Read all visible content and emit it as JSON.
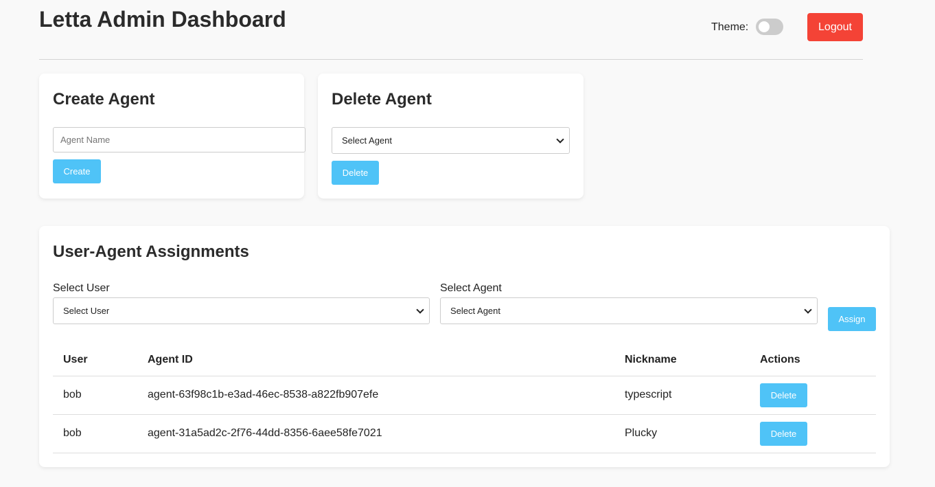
{
  "header": {
    "title": "Letta Admin Dashboard",
    "theme_label": "Theme:",
    "logout_label": "Logout"
  },
  "create_agent": {
    "heading": "Create Agent",
    "name_placeholder": "Agent Name",
    "name_value": "",
    "create_label": "Create"
  },
  "delete_agent": {
    "heading": "Delete Agent",
    "select_value": "Select Agent",
    "delete_label": "Delete"
  },
  "assignments": {
    "heading": "User-Agent Assignments",
    "user_label": "Select User",
    "user_select_value": "Select User",
    "agent_label": "Select Agent",
    "agent_select_value": "Select Agent",
    "assign_label": "Assign",
    "columns": [
      "User",
      "Agent ID",
      "Nickname",
      "Actions"
    ],
    "rows": [
      {
        "user": "bob",
        "agent_id": "agent-63f98c1b-e3ad-46ec-8538-a822fb907efe",
        "nickname": "typescript",
        "action_label": "Delete"
      },
      {
        "user": "bob",
        "agent_id": "agent-31a5ad2c-2f76-44dd-8356-6aee58fe7021",
        "nickname": "Plucky",
        "action_label": "Delete"
      }
    ]
  },
  "colors": {
    "accent": "#4fc3f7",
    "danger": "#f44336",
    "background": "#f9f9f9"
  },
  "theme_dark": false
}
